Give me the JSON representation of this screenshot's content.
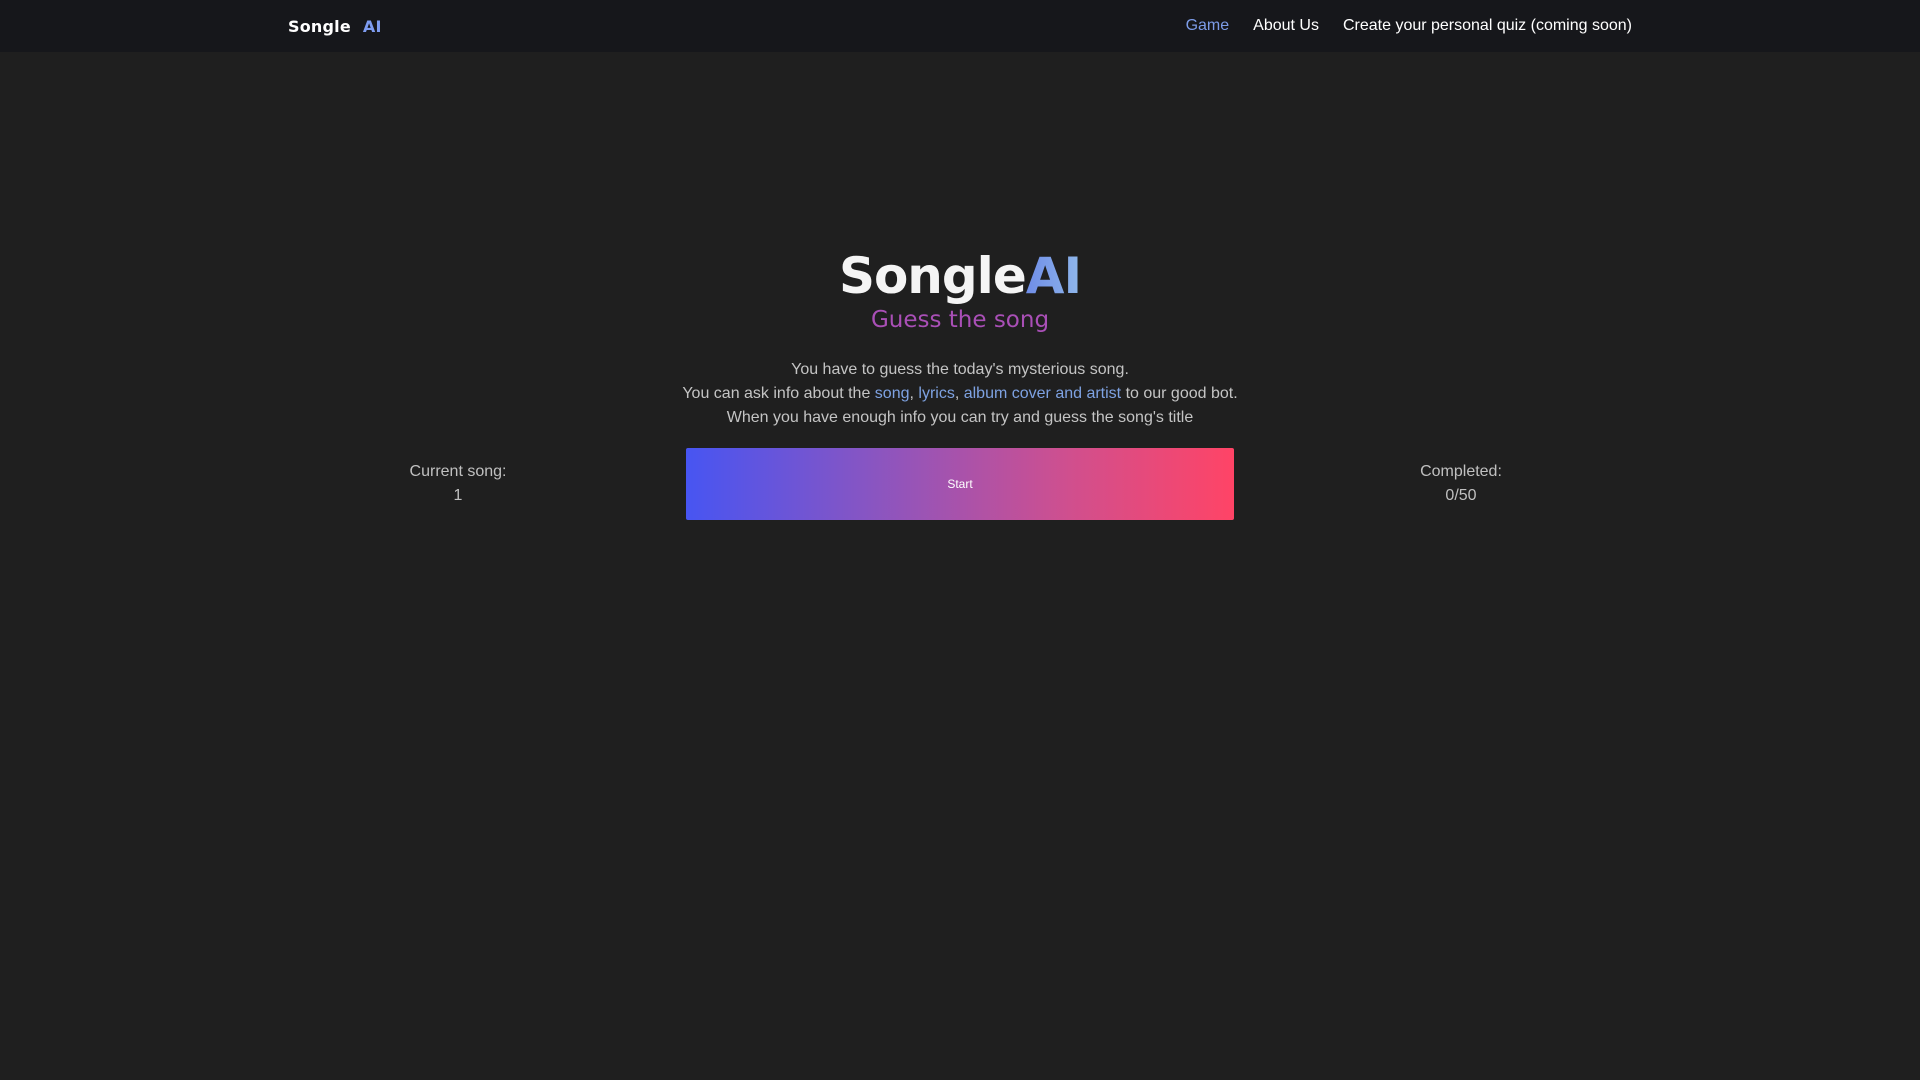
{
  "navbar": {
    "brand_word": "Songle",
    "brand_ai": "AI",
    "links": [
      {
        "label": "Game",
        "active": true
      },
      {
        "label": "About Us",
        "active": false
      },
      {
        "label": "Create your personal quiz (coming soon)",
        "active": false
      }
    ]
  },
  "hero": {
    "logo_word": "Songle",
    "logo_ai": "AI",
    "tagline": "Guess the song",
    "line1": "You have to guess the today's mysterious song.",
    "line2_prefix": "You can ask info about the ",
    "line2_song": "song",
    "line2_sep1": ", ",
    "line2_lyrics": "lyrics",
    "line2_sep2": ", ",
    "line2_album": "album cover and artist",
    "line2_suffix": " to our good bot.",
    "line3": "When you have enough info you can try and guess the song's title"
  },
  "game": {
    "current_song_label": "Current song:",
    "current_song_value": "1",
    "completed_label": "Completed:",
    "completed_value": "0/50",
    "start_label": "Start"
  },
  "colors": {
    "background": "#1f1f1f",
    "navbar": "#16171b",
    "accent_blue": "#7c9ce8",
    "tagline": "#a94fb6",
    "button_gradient_start": "#4755f2",
    "button_gradient_end": "#ff4466"
  }
}
